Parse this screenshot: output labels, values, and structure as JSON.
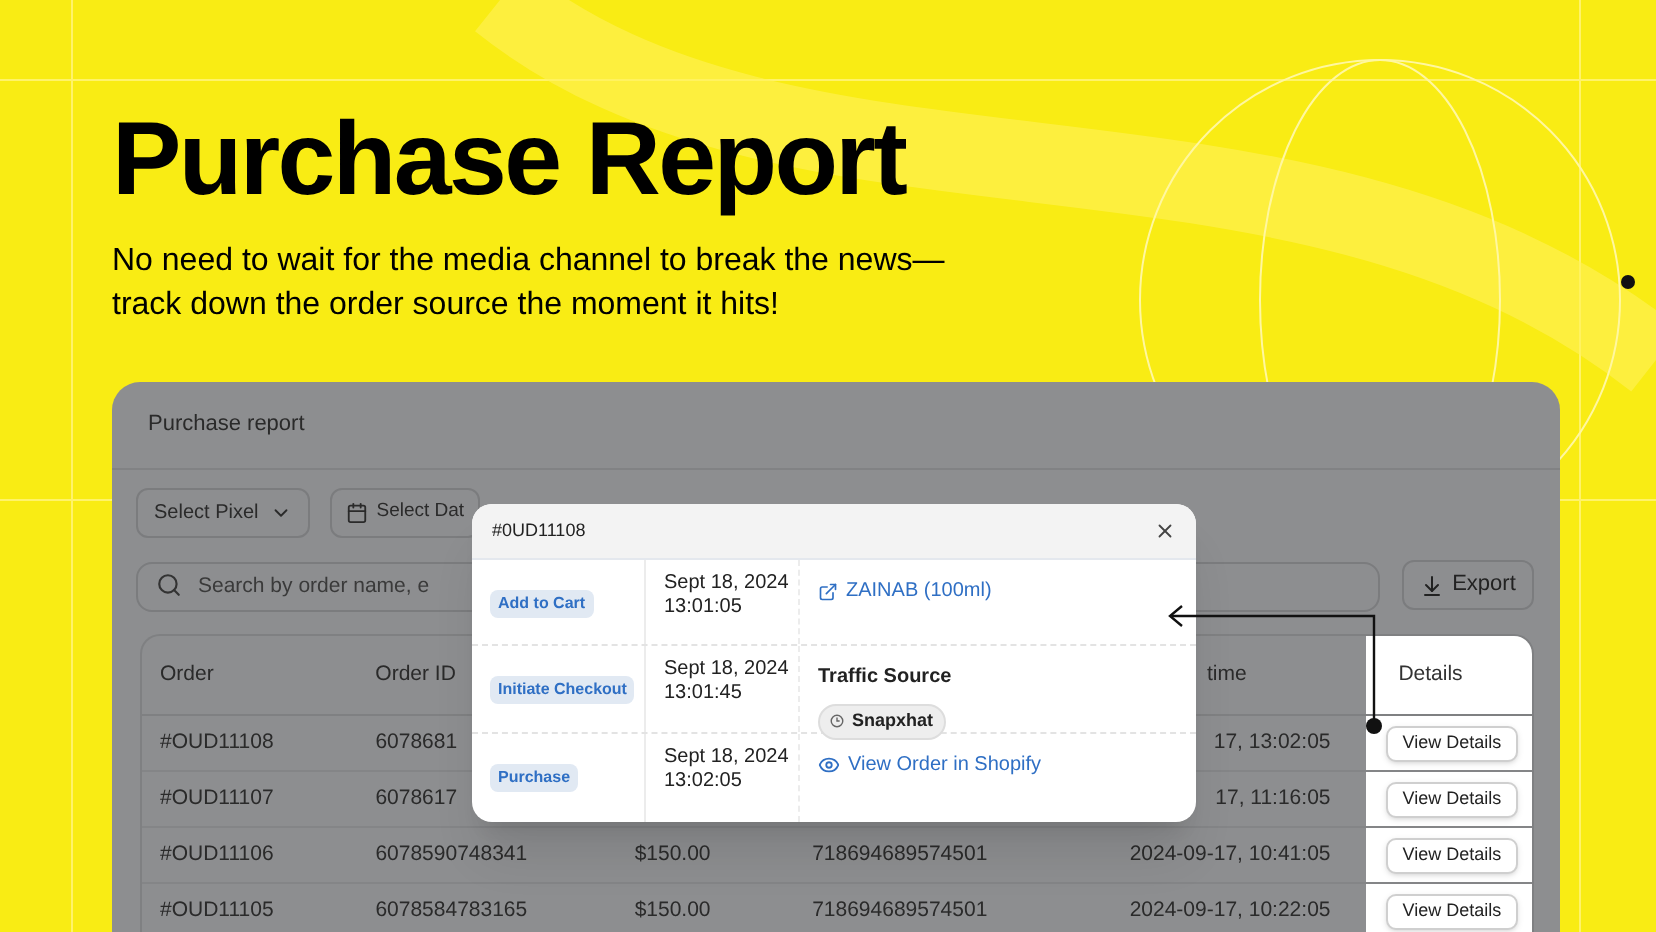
{
  "hero": {
    "title": "Purchase Report",
    "subtitle_lines": [
      "No need to wait for the media channel to break the news—",
      "track down the order source the moment it hits!"
    ]
  },
  "report": {
    "title": "Purchase report",
    "pixel_select": "Select Pixel",
    "date_select": "Select Dat",
    "search": {
      "placeholder": "Search by order name, e"
    },
    "export_button": "Export",
    "table": {
      "columns": {
        "column_1": "Order",
        "column_2": "Order ID",
        "column_5": "time",
        "column_6": "Details"
      },
      "rows": [
        {
          "order": "#OUD11108",
          "order_id": "6078681",
          "time": "17, 13:02:05",
          "action": "View Details"
        },
        {
          "order": "#OUD11107",
          "order_id": "6078617",
          "time": "17, 11:16:05",
          "action": "View Details"
        },
        {
          "order": "#OUD11106",
          "order_id": "6078590748341",
          "column_3": "$150.00",
          "column_4": "718694689574501",
          "time": "2024-09-17, 10:41:05",
          "action": "View Details"
        },
        {
          "order": "#OUD11105",
          "order_id": "6078584783165",
          "column_3": "$150.00",
          "column_4": "718694689574501",
          "time": "2024-09-17, 10:22:05",
          "action": "View Details"
        }
      ]
    }
  },
  "modal": {
    "title": "#0UD11108",
    "events": [
      {
        "badge": "Add to Cart",
        "date": "Sept 18, 2024",
        "time": "13:01:05",
        "kind": "product_link",
        "text": "ZAINAB (100ml)"
      },
      {
        "badge": "Initiate Checkout",
        "date": "Sept 18, 2024",
        "time": "13:01:45",
        "kind": "traffic_source",
        "text": "Traffic Source",
        "chip": "Snapxhat"
      },
      {
        "badge": "Purchase",
        "date": "Sept 18, 2024",
        "time": "13:02:05",
        "kind": "order_link",
        "text": "View Order in Shopify"
      }
    ]
  }
}
